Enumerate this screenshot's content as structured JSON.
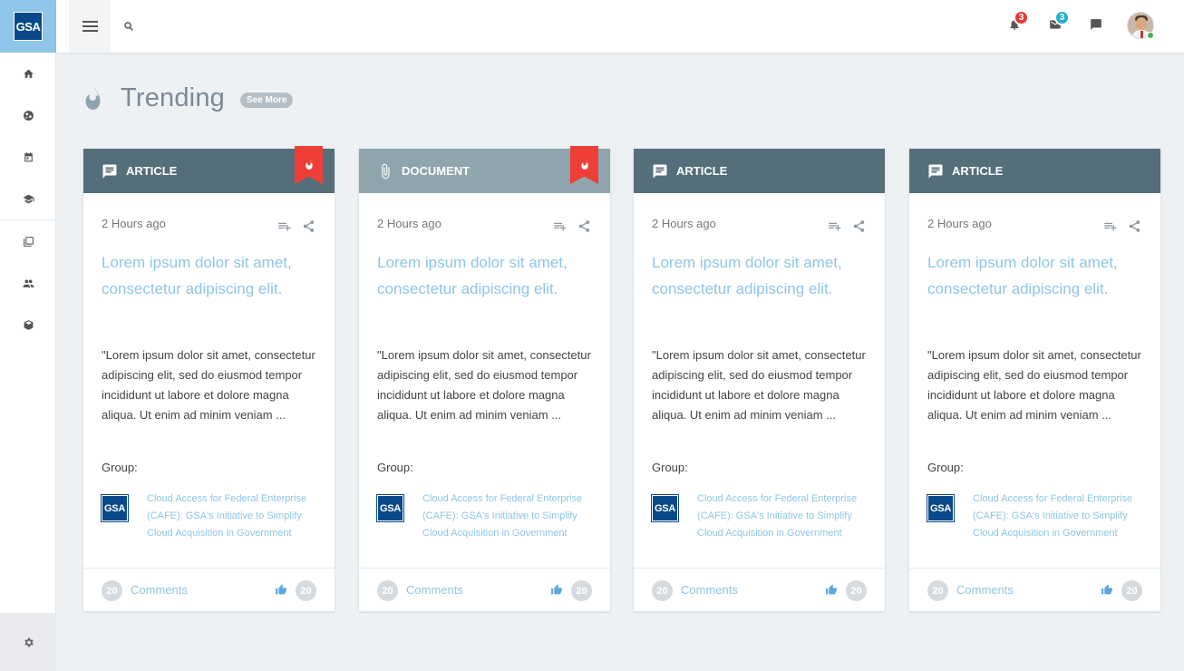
{
  "brand": {
    "logo_text": "GSA",
    "accent": "#8ec5e8",
    "logo_bg": "#0a4a8a"
  },
  "sidebar": {
    "items": [
      {
        "icon": "home-icon"
      },
      {
        "icon": "globe-icon"
      },
      {
        "icon": "calendar-icon"
      },
      {
        "icon": "graduation-cap-icon"
      },
      {
        "icon": "library-icon"
      },
      {
        "icon": "people-icon"
      },
      {
        "icon": "box-icon"
      }
    ],
    "settings_icon": "gear-icon"
  },
  "topbar": {
    "menu_icon": "hamburger-menu-icon",
    "search_icon": "search-icon",
    "notifications": {
      "icon": "bell-icon",
      "count": "3",
      "color": "#e53935"
    },
    "messages": {
      "icon": "mail-icon",
      "count": "3",
      "color": "#1fb3c9"
    },
    "chat": {
      "icon": "chat-icon"
    },
    "avatar": {
      "status_color": "#4caf50"
    }
  },
  "page": {
    "title": "Trending",
    "see_more": "See More"
  },
  "cards": [
    {
      "type_label": "ARTICLE",
      "type": "article",
      "trending": true,
      "time": "2 Hours ago",
      "title": "Lorem ipsum dolor sit amet, consectetur adipiscing elit.",
      "excerpt": "\"Lorem ipsum dolor sit amet, consectetur adipiscing elit, sed do eiusmod tempor incididunt ut labore et dolore magna aliqua. Ut enim ad minim veniam ...",
      "group_label": "Group:",
      "group_logo": "GSA",
      "group_name": "Cloud Access for Federal Enterprise (CAFE): GSA's Initiative to Simplify Cloud Acquisition in Government",
      "comments_count": "20",
      "comments_label": "Comments",
      "likes_count": "20"
    },
    {
      "type_label": "DOCUMENT",
      "type": "document",
      "trending": true,
      "time": "2 Hours ago",
      "title": "Lorem ipsum dolor sit amet, consectetur adipiscing elit.",
      "excerpt": "\"Lorem ipsum dolor sit amet, consectetur adipiscing elit, sed do eiusmod tempor incididunt ut labore et dolore magna aliqua. Ut enim ad minim veniam ...",
      "group_label": "Group:",
      "group_logo": "GSA",
      "group_name": "Cloud Access for Federal Enterprise (CAFE): GSA's Initiative to Simplify Cloud Acquisition in Government",
      "comments_count": "20",
      "comments_label": "Comments",
      "likes_count": "20"
    },
    {
      "type_label": "ARTICLE",
      "type": "article",
      "trending": false,
      "time": "2 Hours ago",
      "title": "Lorem ipsum dolor sit amet, consectetur adipiscing elit.",
      "excerpt": "\"Lorem ipsum dolor sit amet, consectetur adipiscing elit, sed do eiusmod tempor incididunt ut labore et dolore magna aliqua. Ut enim ad minim veniam ...",
      "group_label": "Group:",
      "group_logo": "GSA",
      "group_name": "Cloud Access for Federal Enterprise (CAFE): GSA's Initiative to Simplify Cloud Acquisition in Government",
      "comments_count": "20",
      "comments_label": "Comments",
      "likes_count": "20"
    },
    {
      "type_label": "ARTICLE",
      "type": "article",
      "trending": false,
      "time": "2 Hours ago",
      "title": "Lorem ipsum dolor sit amet, consectetur adipiscing elit.",
      "excerpt": "\"Lorem ipsum dolor sit amet, consectetur adipiscing elit, sed do eiusmod tempor incididunt ut labore et dolore magna aliqua. Ut enim ad minim veniam ...",
      "group_label": "Group:",
      "group_logo": "GSA",
      "group_name": "Cloud Access for Federal Enterprise (CAFE): GSA's Initiative to Simplify Cloud Acquisition in Government",
      "comments_count": "20",
      "comments_label": "Comments",
      "likes_count": "20"
    }
  ]
}
